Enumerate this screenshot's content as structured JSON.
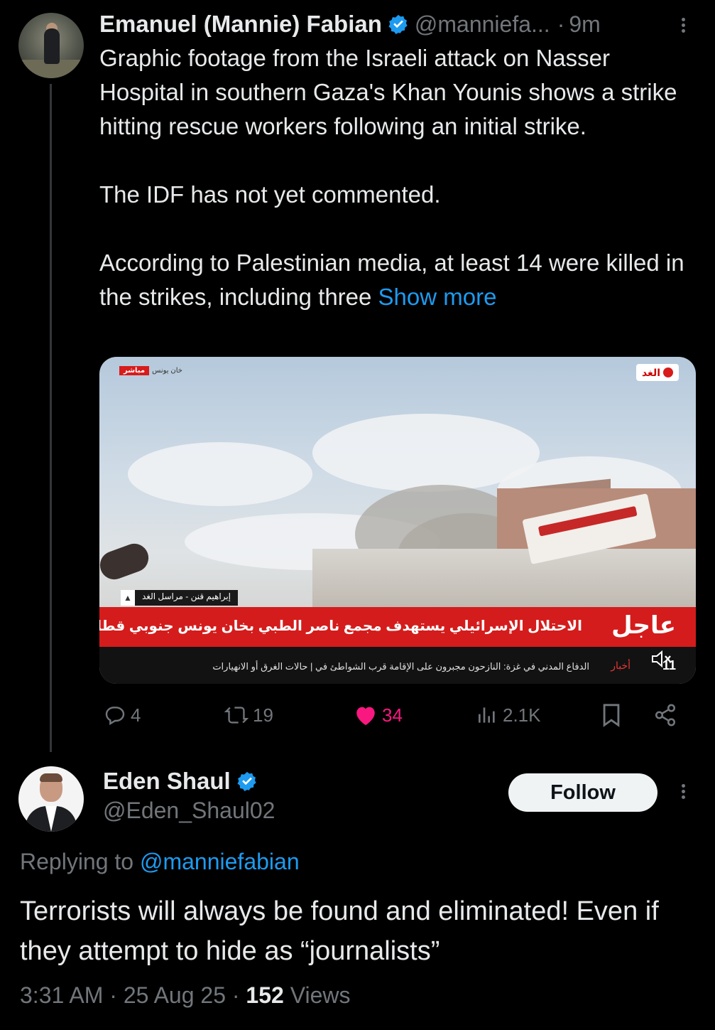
{
  "tweet": {
    "author_name": "Emanuel (Mannie) Fabian",
    "author_handle": "@manniefa...",
    "separator": "·",
    "time": "9m",
    "body_lines": [
      "Graphic footage from the Israeli attack on Nasser Hospital in southern Gaza's Khan Younis shows a strike hitting rescue workers following an initial strike.",
      "The IDF has not yet commented."
    ],
    "body_last": "According to Palestinian media, at least 14 were killed in the strikes, including three ",
    "show_more": "Show more",
    "media": {
      "live_label": "مباشر",
      "location_label": "خان يونس",
      "channel_logo": "الغد",
      "reporter_icon": "",
      "reporter": "إبراهيم قنن - مراسل الغد",
      "headline": "الاحتلال الإسرائيلي يستهدف مجمع ناصر الطبي بخان يونس جنوبي قطاع غزة",
      "breaking_label": "عاجل",
      "ticker_label": "أخبار",
      "ticker": "الدفاع المدني في غزة: النازحون مجبرون على الإقامة قرب الشواطئ في | حالات الغرق أو الانهيارات",
      "clock": "11",
      "mute_icon": "speaker-muted-icon"
    },
    "actions": {
      "replies": "4",
      "reposts": "19",
      "likes": "34",
      "views": "2.1K"
    }
  },
  "reply": {
    "author_name": "Eden Shaul",
    "author_handle": "@Eden_Shaul02",
    "follow_label": "Follow",
    "replying_prefix": "Replying to ",
    "replying_to": "@manniefabian",
    "body": "Terrorists will always be found and eliminated! Even if they attempt to hide as “journalists”",
    "time": "3:31 AM",
    "date": "25 Aug 25",
    "views_count": "152",
    "views_label": " Views",
    "sep": " · "
  },
  "colors": {
    "accent": "#1d9bf0",
    "like": "#f91880",
    "muted": "#71767b",
    "text": "#e7e9ea"
  }
}
